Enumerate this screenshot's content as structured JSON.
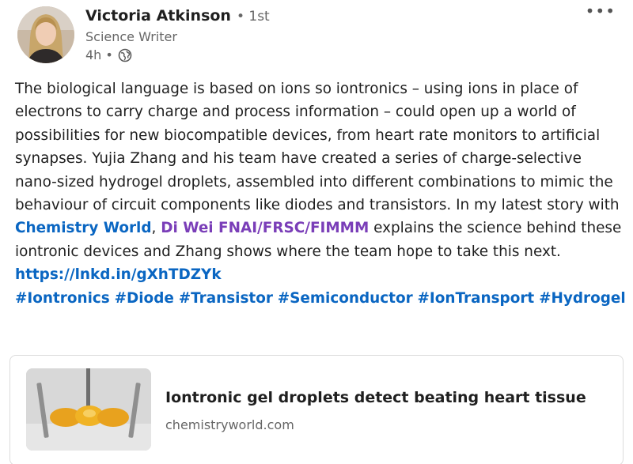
{
  "author": {
    "name": "Victoria Atkinson",
    "connection": "• 1st",
    "headline": "Science Writer",
    "time": "4h •",
    "visibility_icon": "globe-icon"
  },
  "menu": {
    "more_icon": "more-horizontal-icon",
    "more_glyph": "•••"
  },
  "post": {
    "text_part1": "The biological language is based on ions so iontronics – using ions in place of electrons to carry charge and process information – could open up a world of possibilities for new biocompatible devices, from heart rate monitors to artificial synapses. Yujia Zhang and his team have created a series of charge-selective nano-sized hydrogel droplets, assembled into different combinations to mimic the behaviour of circuit components like diodes and transistors. In my latest story with ",
    "mention1": "Chemistry World",
    "text_part2": ", ",
    "mention2": "Di Wei FNAI/FRSC/FIMMM",
    "text_part3": " explains the science behind these iontronic devices and Zhang shows where the team hope to take this next.",
    "link": "https://lnkd.in/gXhTDZYk",
    "hashtags": [
      "#Iontronics",
      "#Diode",
      "#Transistor",
      "#Semiconductor",
      "#IonTransport",
      "#Hydrogel"
    ]
  },
  "link_card": {
    "title": "Iontronic gel droplets detect beating heart tissue",
    "domain": "chemistryworld.com"
  },
  "colors": {
    "link_blue": "#0a66c2",
    "mention_purple": "#7a3eb8",
    "text": "#1f1f1f",
    "muted": "#666666"
  }
}
